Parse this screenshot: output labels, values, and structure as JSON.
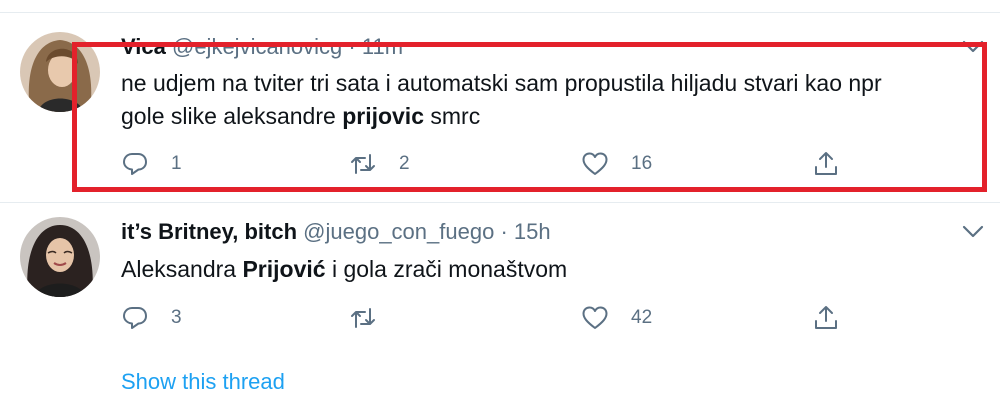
{
  "tweets": [
    {
      "name": "Vica",
      "handle": "@ejkejvicanovicg",
      "separator": "·",
      "time": "11m",
      "text_before": "ne udjem na tviter tri sata i automatski sam propustila hiljadu stvari kao npr",
      "text_line2_before": "gole slike aleksandre ",
      "text_bold": "prijovic",
      "text_after": " smrc",
      "reply_count": "1",
      "retweet_count": "2",
      "like_count": "16"
    },
    {
      "name": "it’s Britney, bitch",
      "handle": "@juego_con_fuego",
      "separator": "·",
      "time": "15h",
      "text_before": "Aleksandra ",
      "text_bold": "Prijović",
      "text_after": " i gola zrači monaštvom",
      "reply_count": "3",
      "retweet_count": "",
      "like_count": "42"
    }
  ],
  "show_thread_label": "Show this thread",
  "colors": {
    "highlight": "#e3212b",
    "link": "#1da1f2",
    "muted": "#5b7083"
  },
  "icons": [
    "reply-icon",
    "retweet-icon",
    "like-icon",
    "share-icon",
    "chevron-down-icon"
  ]
}
